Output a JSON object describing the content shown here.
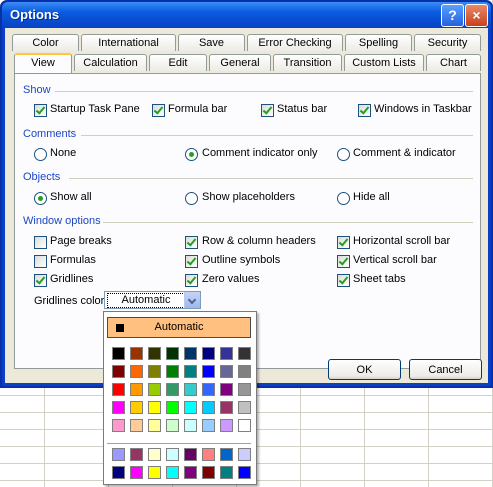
{
  "window": {
    "title": "Options",
    "help_glyph": "?",
    "close_glyph": "×"
  },
  "tabs_row1": [
    "Color",
    "International",
    "Save",
    "Error Checking",
    "Spelling",
    "Security"
  ],
  "tabs_row2": [
    "View",
    "Calculation",
    "Edit",
    "General",
    "Transition",
    "Custom Lists",
    "Chart"
  ],
  "active_tab": "View",
  "show": {
    "heading": "Show",
    "items": [
      {
        "label": "Startup Task Pane",
        "checked": true
      },
      {
        "label": "Formula bar",
        "checked": true
      },
      {
        "label": "Status bar",
        "checked": true
      },
      {
        "label": "Windows in Taskbar",
        "checked": true
      }
    ]
  },
  "comments": {
    "heading": "Comments",
    "options": [
      {
        "label": "None",
        "selected": false
      },
      {
        "label": "Comment indicator only",
        "selected": true
      },
      {
        "label": "Comment & indicator",
        "selected": false
      }
    ]
  },
  "objects": {
    "heading": "Objects",
    "options": [
      {
        "label": "Show all",
        "selected": true
      },
      {
        "label": "Show placeholders",
        "selected": false
      },
      {
        "label": "Hide all",
        "selected": false
      }
    ]
  },
  "window_options": {
    "heading": "Window options",
    "items": [
      {
        "label": "Page breaks",
        "checked": false
      },
      {
        "label": "Formulas",
        "checked": false
      },
      {
        "label": "Gridlines",
        "checked": true
      },
      {
        "label": "Row & column headers",
        "checked": true
      },
      {
        "label": "Outline symbols",
        "checked": true
      },
      {
        "label": "Zero values",
        "checked": true
      },
      {
        "label": "Horizontal scroll bar",
        "checked": true
      },
      {
        "label": "Vertical scroll bar",
        "checked": true
      },
      {
        "label": "Sheet tabs",
        "checked": true
      }
    ],
    "gridlines_color_label": "Gridlines color:",
    "gridlines_color_value": "Automatic"
  },
  "buttons": {
    "ok": "OK",
    "cancel": "Cancel"
  },
  "palette": {
    "automatic_label": "Automatic",
    "rows": [
      [
        "#000000",
        "#993300",
        "#333300",
        "#003300",
        "#003366",
        "#000080",
        "#333399",
        "#333333"
      ],
      [
        "#800000",
        "#ff6600",
        "#808000",
        "#008000",
        "#008080",
        "#0000ff",
        "#666699",
        "#808080"
      ],
      [
        "#ff0000",
        "#ff9900",
        "#99cc00",
        "#339966",
        "#33cccc",
        "#3366ff",
        "#800080",
        "#969696"
      ],
      [
        "#ff00ff",
        "#ffcc00",
        "#ffff00",
        "#00ff00",
        "#00ffff",
        "#00ccff",
        "#993366",
        "#c0c0c0"
      ],
      [
        "#ff99cc",
        "#ffcc99",
        "#ffff99",
        "#ccffcc",
        "#ccffff",
        "#99ccff",
        "#cc99ff",
        "#ffffff"
      ]
    ],
    "extra_rows": [
      [
        "#9999ff",
        "#993366",
        "#ffffcc",
        "#ccffff",
        "#660066",
        "#ff8080",
        "#0066cc",
        "#ccccff"
      ],
      [
        "#000080",
        "#ff00ff",
        "#ffff00",
        "#00ffff",
        "#800080",
        "#800000",
        "#008080",
        "#0000ff"
      ]
    ]
  }
}
